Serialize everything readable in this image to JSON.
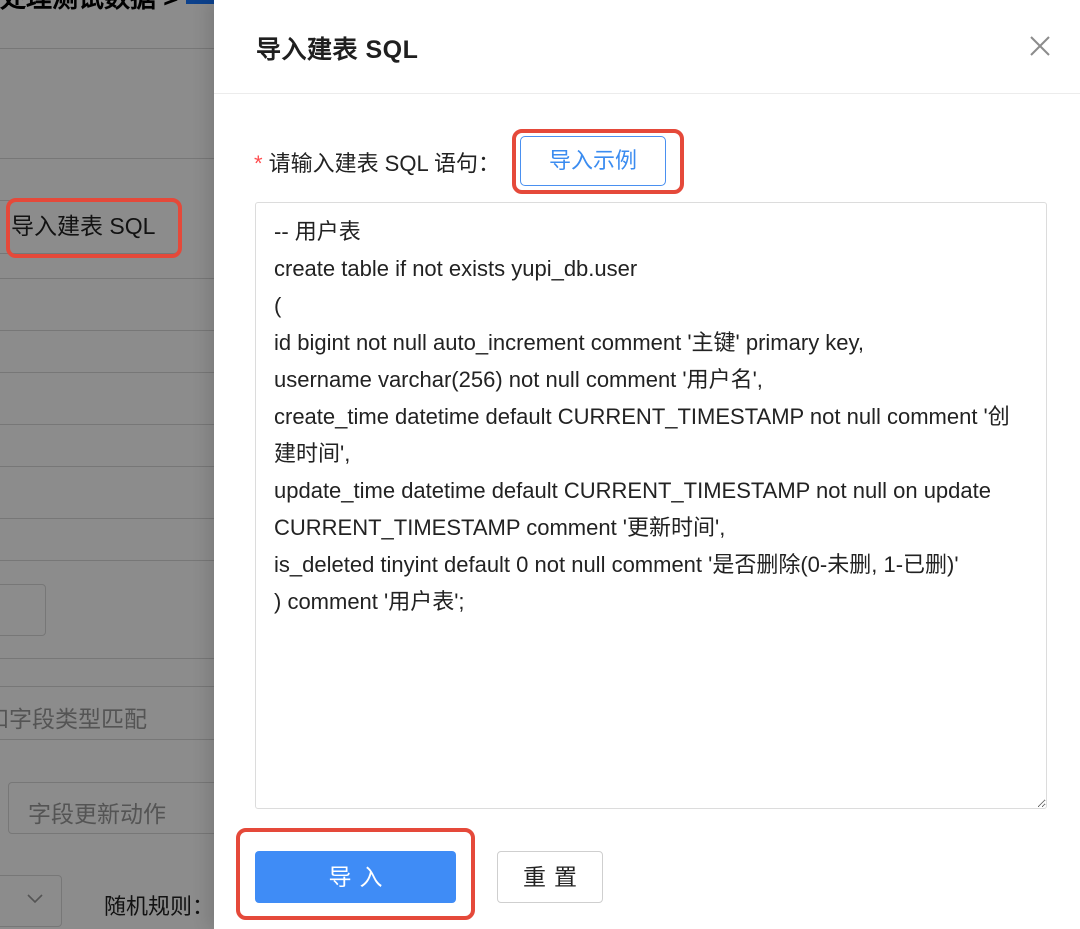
{
  "background": {
    "title_fragment": "处理测试数据 >",
    "import_sql_button": "导入建表 SQL",
    "field_type_match_text": "和字段类型匹配",
    "field_update_action_placeholder": "字段更新动作",
    "random_rule_label": "随机规则："
  },
  "drawer": {
    "title": "导入建表 SQL",
    "close_icon": "close-icon",
    "form": {
      "required_mark": "*",
      "label": "请输入建表 SQL 语句：",
      "example_button": "导入示例",
      "sql_value": "-- 用户表\ncreate table if not exists yupi_db.user\n(\nid bigint not null auto_increment comment '主键' primary key,\nusername varchar(256) not null comment '用户名',\ncreate_time datetime default CURRENT_TIMESTAMP not null comment '创建时间',\nupdate_time datetime default CURRENT_TIMESTAMP not null on update CURRENT_TIMESTAMP comment '更新时间',\nis_deleted tinyint default 0 not null comment '是否删除(0-未删, 1-已删)'\n) comment '用户表';"
    },
    "footer": {
      "import_button": "导入",
      "reset_button": "重置"
    }
  },
  "colors": {
    "primary": "#3f8cf6",
    "highlight_border": "#e5493a",
    "required": "#ff4d4f"
  }
}
